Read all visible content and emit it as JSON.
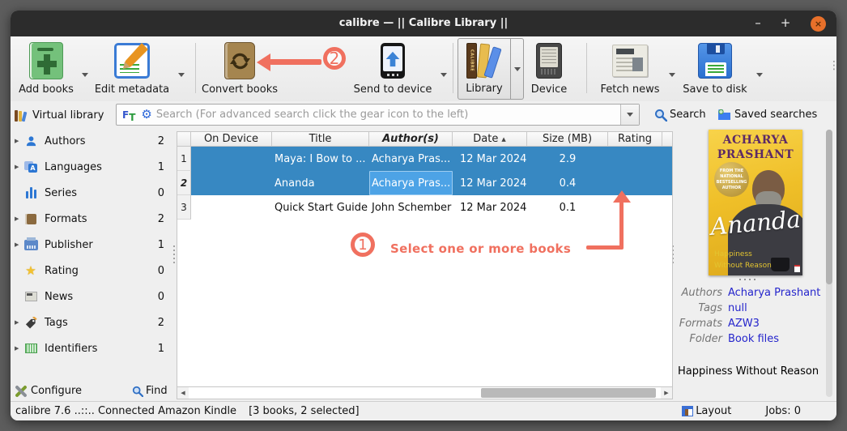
{
  "titlebar": {
    "title": "calibre — || Calibre Library ||",
    "minimize": "–",
    "maximize": "+",
    "close": "×"
  },
  "toolbar": {
    "add_books": "Add books",
    "edit_metadata": "Edit metadata",
    "convert_books": "Convert books",
    "send_to_device": "Send to device",
    "library": "Library",
    "device": "Device",
    "fetch_news": "Fetch news",
    "save_to_disk": "Save to disk"
  },
  "searchbar": {
    "virtual_library": "Virtual library",
    "placeholder": "Search (For advanced search click the gear icon to the left)",
    "search_label": "Search",
    "saved_searches": "Saved searches"
  },
  "sidebar": {
    "items": [
      {
        "label": "Authors",
        "count": "2"
      },
      {
        "label": "Languages",
        "count": "1"
      },
      {
        "label": "Series",
        "count": "0"
      },
      {
        "label": "Formats",
        "count": "2"
      },
      {
        "label": "Publisher",
        "count": "1"
      },
      {
        "label": "Rating",
        "count": "0"
      },
      {
        "label": "News",
        "count": "0"
      },
      {
        "label": "Tags",
        "count": "2"
      },
      {
        "label": "Identifiers",
        "count": "1"
      }
    ],
    "configure": "Configure",
    "find": "Find"
  },
  "book_table": {
    "columns": [
      "On Device",
      "Title",
      "Author(s)",
      "Date",
      "Size (MB)",
      "Rating"
    ],
    "sort_column": "Date",
    "rows": [
      {
        "num": "1",
        "on_device": "",
        "title": "Maya: I Bow to ...",
        "authors": "Acharya Pras...",
        "date": "12 Mar 2024",
        "size": "2.9",
        "rating": ""
      },
      {
        "num": "2",
        "on_device": "",
        "title": "Ananda",
        "authors": "Acharya Pras...",
        "date": "12 Mar 2024",
        "size": "0.4",
        "rating": ""
      },
      {
        "num": "3",
        "on_device": "",
        "title": "Quick Start Guide",
        "authors": "John Schember",
        "date": "12 Mar 2024",
        "size": "0.1",
        "rating": ""
      }
    ]
  },
  "book_details": {
    "cover": {
      "author_name": "ACHARYA PRASHANT",
      "badge": "From the National Bestselling Author",
      "title_script": "Ananda",
      "subtitle_line1": "Happiness",
      "subtitle_line2": "Without Reason"
    },
    "fields": [
      {
        "label": "Authors",
        "value": "Acharya Prashant"
      },
      {
        "label": "Tags",
        "value": "null"
      },
      {
        "label": "Formats",
        "value": "AZW3"
      },
      {
        "label": "Folder",
        "value": "Book files"
      }
    ],
    "comment": "Happiness Without Reason"
  },
  "statusbar": {
    "left": "calibre 7.6 ..::.. Connected Amazon Kindle",
    "selection": "[3 books, 2 selected]",
    "layout": "Layout",
    "jobs": "Jobs: 0"
  },
  "annotations": {
    "step1_number": "1",
    "step1_text": "Select one or more books",
    "step2_number": "2",
    "accent_color": "#f0705f"
  },
  "icons": {
    "gear": "⚙",
    "overflow": "⋮",
    "ft_f": "F",
    "ft_t": "T",
    "sort_asc": "▲",
    "star": "★",
    "expand": "▶",
    "scroll_left": "◀",
    "scroll_right": "▶",
    "library_spine": "CALIBRE"
  }
}
